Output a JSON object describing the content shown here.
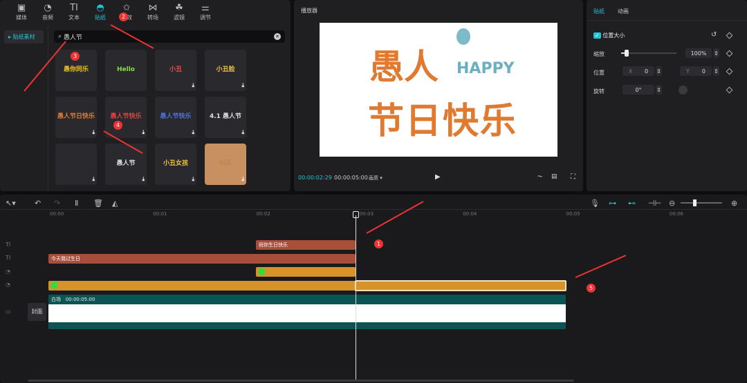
{
  "toolbar": [
    {
      "label": "媒体",
      "icon": "media-icon"
    },
    {
      "label": "音频",
      "icon": "audio-icon"
    },
    {
      "label": "文本",
      "icon": "text-icon"
    },
    {
      "label": "贴纸",
      "icon": "sticker-icon",
      "active": true
    },
    {
      "label": "特效",
      "icon": "effects-icon"
    },
    {
      "label": "转场",
      "icon": "transition-icon"
    },
    {
      "label": "滤镜",
      "icon": "filter-icon"
    },
    {
      "label": "调节",
      "icon": "adjust-icon"
    }
  ],
  "sidebar": {
    "item": "▸ 贴纸素材"
  },
  "search": {
    "value": "愚人节"
  },
  "stickers": [
    "愚你同乐",
    "Hello",
    "小丑",
    "小丑脸",
    "愚人节日快乐",
    "愚人节快乐",
    "愚人节快乐",
    "4.1 愚人节",
    "",
    "愚人节",
    "小丑女孩",
    "柯基"
  ],
  "preview": {
    "title": "播放器",
    "current_time": "00:00:02:29",
    "total_time": "00:00:05:00",
    "ratio": "画质",
    "canvas_text1": "愚人",
    "canvas_text2": "HAPPY",
    "canvas_text3": "节日快乐"
  },
  "right": {
    "tabs": [
      "贴纸",
      "动画"
    ],
    "section": "位置大小",
    "scale_label": "缩放",
    "scale_value": "100%",
    "scale_fraction": 0.1,
    "position_label": "位置",
    "x_label": "X",
    "x_value": "0",
    "y_label": "Y",
    "y_value": "0",
    "rotate_label": "旋转",
    "rotate_value": "0°"
  },
  "timeline": {
    "ticks": [
      "00:00",
      "00:01",
      "00:02",
      "00:03",
      "00:04",
      "00:05",
      "00:06"
    ],
    "text_clip_1": "祝你生日快乐",
    "text_clip_2": "今天我过生日",
    "main_clip_name": "白场",
    "main_clip_duration": "00:00:05:00",
    "cover": "封面"
  },
  "annotations": [
    "1",
    "2",
    "3",
    "4",
    "5"
  ],
  "colors": {
    "accent": "#22c3d3",
    "text_clip": "#a84f3c",
    "sticker_clip": "#d8922a",
    "main_clip": "#0b5454",
    "annotation": "#e33333"
  }
}
